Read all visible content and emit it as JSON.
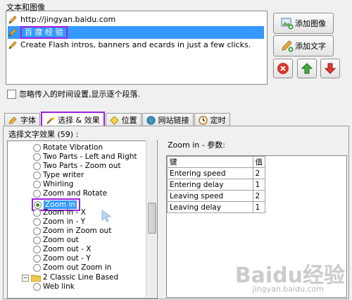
{
  "group_title": "文本和图像",
  "text_items": [
    {
      "text": "http://jingyan.baidu.com",
      "icon": "pencil-icon"
    },
    {
      "text": "百 度 经 验",
      "icon": "pencil-icon",
      "selected": true
    },
    {
      "text": "Create Flash intros, banners and ecards in just a few clicks.",
      "icon": "pencil-icon"
    }
  ],
  "buttons": {
    "add_image": "添加图像",
    "add_text": "添加文字"
  },
  "ignore_timing_label": "忽略传入的时间设置,显示逐个段落.",
  "tabs": [
    {
      "label": "字体",
      "icon": "font-icon"
    },
    {
      "label": "选择 & 效果",
      "icon": "wand-icon",
      "active": true
    },
    {
      "label": "位置",
      "icon": "position-icon"
    },
    {
      "label": "网站链接",
      "icon": "globe-icon"
    },
    {
      "label": "定时",
      "icon": "clock-icon"
    }
  ],
  "effects_label": "选择文字效果 (59) :",
  "effects": [
    "Rotate Vibration",
    "Two Parts - Left and Right",
    "Two Parts - Zoom out",
    "Type writer",
    "Whirling",
    "Zoom and Rotate",
    "Zoom in",
    "Zoom in - X",
    "Zoom in - Y",
    "Zoom in Zoom out",
    "Zoom out",
    "Zoom out - X",
    "Zoom out - Y",
    "Zoom out Zoom in"
  ],
  "selected_effect": "Zoom in",
  "folder_item": "2 Classic Line Based",
  "sub_item": "Web link",
  "params_title": "Zoom in - 参数:",
  "params_headers": {
    "key": "键",
    "value": "值"
  },
  "params": [
    {
      "key": "Entering speed",
      "value": "2"
    },
    {
      "key": "Entering delay",
      "value": "1"
    },
    {
      "key": "Leaving speed",
      "value": "2"
    },
    {
      "key": "Leaving delay",
      "value": "1"
    }
  ],
  "watermark": "Baidu经验",
  "watermark_url": "jingyan.baidu.com"
}
